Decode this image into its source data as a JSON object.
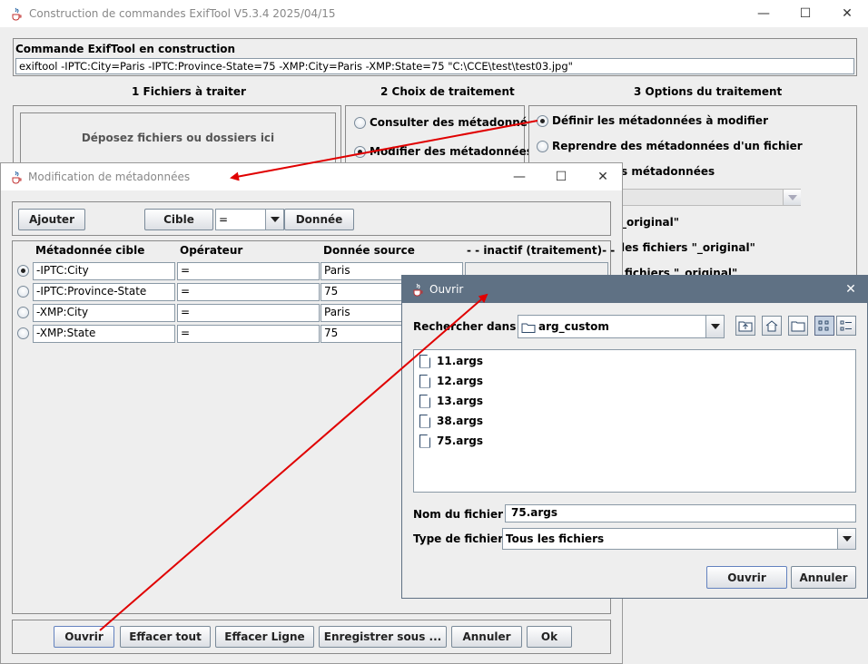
{
  "main_window": {
    "title": "Construction de commandes ExifTool V5.3.4 2025/04/15",
    "command_label": "Commande ExifTool en construction",
    "command_value": "exiftool  -IPTC:City=Paris -IPTC:Province-State=75 -XMP:City=Paris -XMP:State=75 \"C:\\CCE\\test\\test03.jpg\"",
    "section1": "1  Fichiers à traiter",
    "section2": "2  Choix de traitement",
    "section3": "3 Options du traitement",
    "dropzone": "Déposez fichiers ou dossiers ici",
    "consult_option": "Consulter des métadonnées",
    "modify_option": "Modifier des métadonnées",
    "define_option": "Définir les métadonnées à modifier",
    "reprise_option": "Reprendre des métadonnées d'un fichier",
    "partial_1": "s métadonnées",
    "partial_2": "_original\"",
    "partial_3": "les fichiers \"_original\"",
    "partial_4": "fichiers \"_original\""
  },
  "modif_dialog": {
    "title": "Modification de métadonnées",
    "ajouter": "Ajouter",
    "cible": "Cible",
    "operator_value": "=",
    "donnee": "Donnée",
    "columns": [
      "Métadonnée cible",
      "Opérateur",
      "Donnée source",
      "- - inactif (traitement)- -"
    ],
    "rows": [
      {
        "target": "-IPTC:City",
        "op": "=",
        "source": "Paris"
      },
      {
        "target": "-IPTC:Province-State",
        "op": "=",
        "source": "75"
      },
      {
        "target": "-XMP:City",
        "op": "=",
        "source": "Paris"
      },
      {
        "target": "-XMP:State",
        "op": "=",
        "source": "75"
      }
    ],
    "buttons": {
      "ouvrir": "Ouvrir",
      "effacer_tout": "Effacer tout",
      "effacer_ligne": "Effacer Ligne",
      "enregistrer": "Enregistrer sous ...",
      "annuler": "Annuler",
      "ok": "Ok"
    }
  },
  "open_dialog": {
    "title": "Ouvrir",
    "look_in_label": "Rechercher dans :",
    "look_in_value": "arg_custom",
    "files": [
      "11.args",
      "12.args",
      "13.args",
      "38.args",
      "75.args"
    ],
    "filename_label": "Nom du fichier :",
    "filename_value": "75.args",
    "filetype_label": "Type de fichier :",
    "filetype_value": "Tous les fichiers",
    "ouvrir": "Ouvrir",
    "annuler": "Annuler"
  },
  "icons": {
    "app": "java-cup-icon",
    "minimize": "minimize-icon",
    "maximize": "maximize-icon",
    "close": "close-icon",
    "folder": "folder-icon",
    "file": "file-icon"
  },
  "colors": {
    "arrow": "#e00000",
    "dialog_titlebar": "#5f7184",
    "window_bg": "#eeeeee"
  }
}
